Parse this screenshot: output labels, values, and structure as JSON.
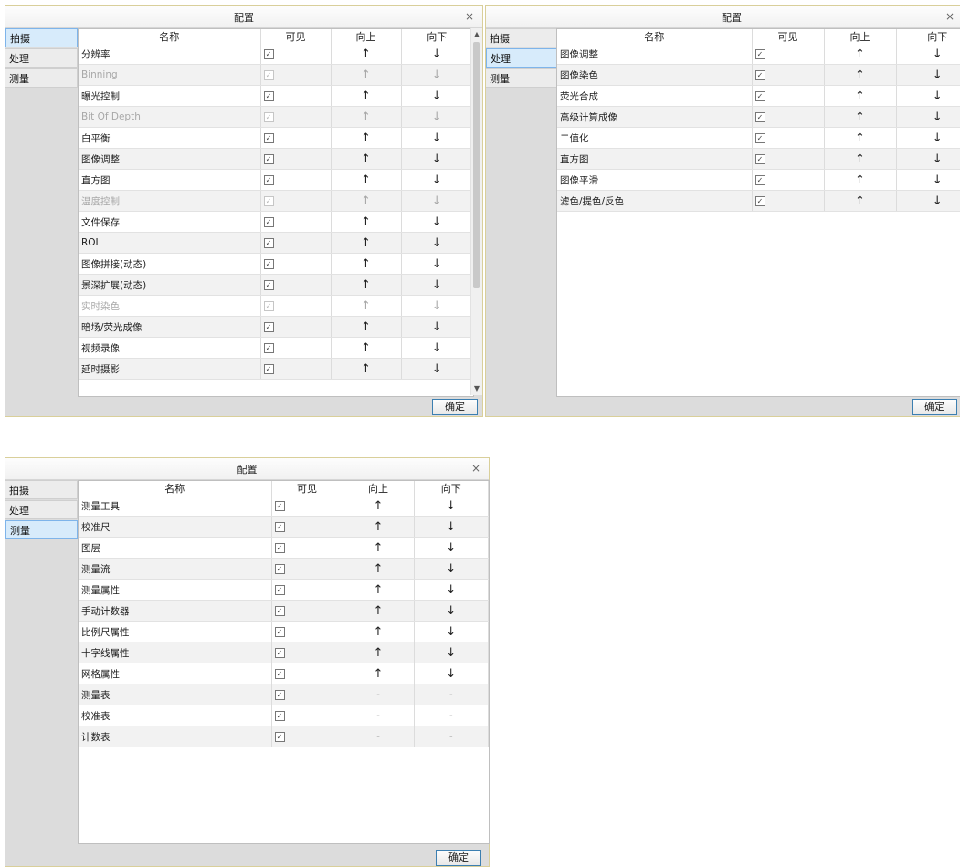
{
  "dialogs": [
    {
      "title": "配置",
      "close": "×",
      "ok_label": "确定",
      "sidebar": [
        "拍摄",
        "处理",
        "测量"
      ],
      "active_tab": 0,
      "columns": [
        "名称",
        "可见",
        "向上",
        "向下"
      ],
      "rows": [
        {
          "name": "分辨率",
          "enabled": true,
          "up": "↑",
          "down": "↓"
        },
        {
          "name": "Binning",
          "enabled": false,
          "up": "↑",
          "down": "↓"
        },
        {
          "name": "曝光控制",
          "enabled": true,
          "up": "↑",
          "down": "↓"
        },
        {
          "name": "Bit Of Depth",
          "enabled": false,
          "up": "↑",
          "down": "↓"
        },
        {
          "name": "白平衡",
          "enabled": true,
          "up": "↑",
          "down": "↓"
        },
        {
          "name": "图像调整",
          "enabled": true,
          "up": "↑",
          "down": "↓"
        },
        {
          "name": "直方图",
          "enabled": true,
          "up": "↑",
          "down": "↓"
        },
        {
          "name": "温度控制",
          "enabled": false,
          "up": "↑",
          "down": "↓"
        },
        {
          "name": "文件保存",
          "enabled": true,
          "up": "↑",
          "down": "↓"
        },
        {
          "name": "ROI",
          "enabled": true,
          "up": "↑",
          "down": "↓"
        },
        {
          "name": "图像拼接(动态)",
          "enabled": true,
          "up": "↑",
          "down": "↓"
        },
        {
          "name": "景深扩展(动态)",
          "enabled": true,
          "up": "↑",
          "down": "↓"
        },
        {
          "name": "实时染色",
          "enabled": false,
          "up": "↑",
          "down": "↓"
        },
        {
          "name": "暗场/荧光成像",
          "enabled": true,
          "up": "↑",
          "down": "↓"
        },
        {
          "name": "视频录像",
          "enabled": true,
          "up": "↑",
          "down": "↓"
        },
        {
          "name": "延时摄影",
          "enabled": true,
          "up": "↑",
          "down": "↓"
        }
      ]
    },
    {
      "title": "配置",
      "close": "×",
      "ok_label": "确定",
      "sidebar": [
        "拍摄",
        "处理",
        "测量"
      ],
      "active_tab": 1,
      "columns": [
        "名称",
        "可见",
        "向上",
        "向下"
      ],
      "rows": [
        {
          "name": "图像调整",
          "enabled": true,
          "up": "↑",
          "down": "↓"
        },
        {
          "name": "图像染色",
          "enabled": true,
          "up": "↑",
          "down": "↓"
        },
        {
          "name": "荧光合成",
          "enabled": true,
          "up": "↑",
          "down": "↓"
        },
        {
          "name": "高级计算成像",
          "enabled": true,
          "up": "↑",
          "down": "↓"
        },
        {
          "name": "二值化",
          "enabled": true,
          "up": "↑",
          "down": "↓"
        },
        {
          "name": "直方图",
          "enabled": true,
          "up": "↑",
          "down": "↓"
        },
        {
          "name": "图像平滑",
          "enabled": true,
          "up": "↑",
          "down": "↓"
        },
        {
          "name": "滤色/提色/反色",
          "enabled": true,
          "up": "↑",
          "down": "↓"
        }
      ]
    },
    {
      "title": "配置",
      "close": "×",
      "ok_label": "确定",
      "sidebar": [
        "拍摄",
        "处理",
        "测量"
      ],
      "active_tab": 2,
      "columns": [
        "名称",
        "可见",
        "向上",
        "向下"
      ],
      "rows": [
        {
          "name": "测量工具",
          "enabled": true,
          "up": "↑",
          "down": "↓"
        },
        {
          "name": "校准尺",
          "enabled": true,
          "up": "↑",
          "down": "↓"
        },
        {
          "name": "图层",
          "enabled": true,
          "up": "↑",
          "down": "↓"
        },
        {
          "name": "测量流",
          "enabled": true,
          "up": "↑",
          "down": "↓"
        },
        {
          "name": "测量属性",
          "enabled": true,
          "up": "↑",
          "down": "↓"
        },
        {
          "name": "手动计数器",
          "enabled": true,
          "up": "↑",
          "down": "↓"
        },
        {
          "name": "比例尺属性",
          "enabled": true,
          "up": "↑",
          "down": "↓"
        },
        {
          "name": "十字线属性",
          "enabled": true,
          "up": "↑",
          "down": "↓"
        },
        {
          "name": "网格属性",
          "enabled": true,
          "up": "↑",
          "down": "↓"
        },
        {
          "name": "测量表",
          "enabled": true,
          "up": "-",
          "down": "-"
        },
        {
          "name": "校准表",
          "enabled": true,
          "up": "-",
          "down": "-"
        },
        {
          "name": "计数表",
          "enabled": true,
          "up": "-",
          "down": "-"
        }
      ]
    }
  ],
  "checkbox_glyph": "✓",
  "scrollbar": {
    "up_glyph": "▲",
    "down_glyph": "▼"
  }
}
